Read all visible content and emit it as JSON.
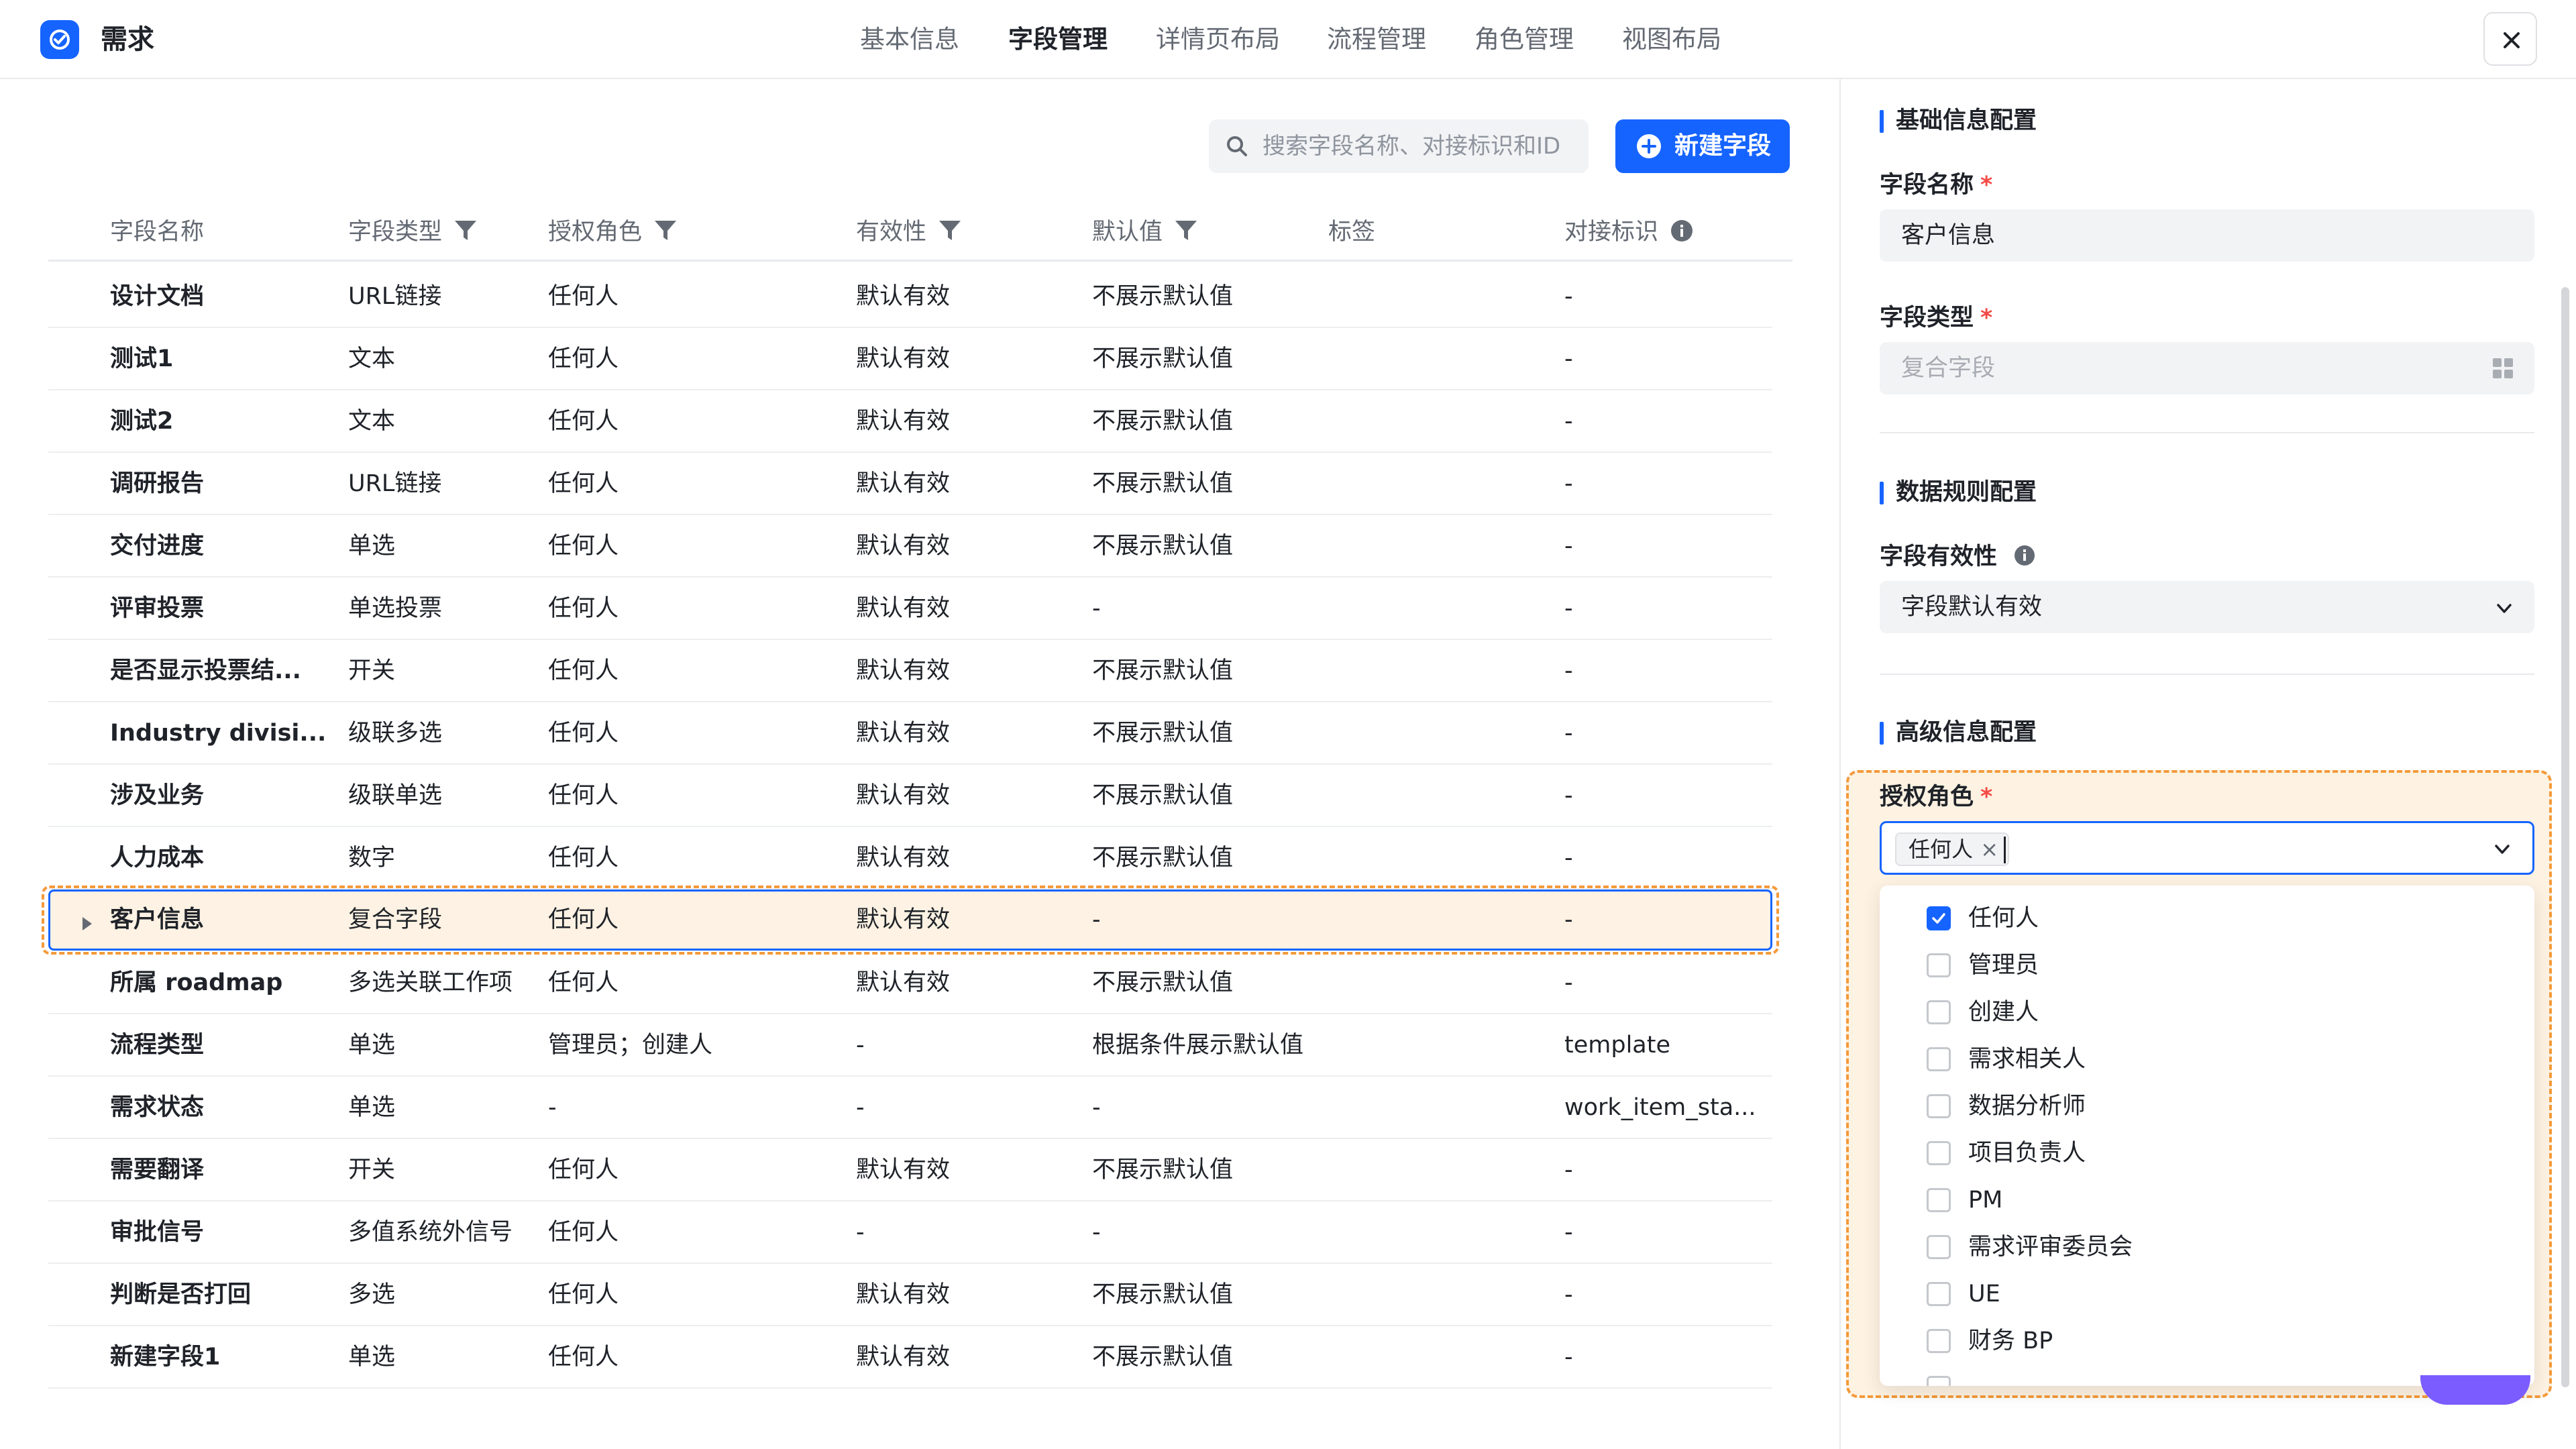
{
  "app": {
    "title": "需求"
  },
  "nav": {
    "tabs": [
      {
        "label": "基本信息",
        "active": false
      },
      {
        "label": "字段管理",
        "active": true
      },
      {
        "label": "详情页布局",
        "active": false
      },
      {
        "label": "流程管理",
        "active": false
      },
      {
        "label": "角色管理",
        "active": false
      },
      {
        "label": "视图布局",
        "active": false
      }
    ]
  },
  "toolbar": {
    "search_placeholder": "搜索字段名称、对接标识和ID",
    "new_field_label": "新建字段"
  },
  "table": {
    "columns": [
      "字段名称",
      "字段类型",
      "授权角色",
      "有效性",
      "默认值",
      "标签",
      "对接标识"
    ],
    "rows": [
      {
        "name": "设计文档",
        "type": "URL链接",
        "role": "任何人",
        "validity": "默认有效",
        "default": "不展示默认值",
        "tag": "",
        "key": "-"
      },
      {
        "name": "测试1",
        "type": "文本",
        "role": "任何人",
        "validity": "默认有效",
        "default": "不展示默认值",
        "tag": "",
        "key": "-"
      },
      {
        "name": "测试2",
        "type": "文本",
        "role": "任何人",
        "validity": "默认有效",
        "default": "不展示默认值",
        "tag": "",
        "key": "-"
      },
      {
        "name": "调研报告",
        "type": "URL链接",
        "role": "任何人",
        "validity": "默认有效",
        "default": "不展示默认值",
        "tag": "",
        "key": "-"
      },
      {
        "name": "交付进度",
        "type": "单选",
        "role": "任何人",
        "validity": "默认有效",
        "default": "不展示默认值",
        "tag": "",
        "key": "-"
      },
      {
        "name": "评审投票",
        "type": "单选投票",
        "role": "任何人",
        "validity": "默认有效",
        "default": "-",
        "tag": "",
        "key": "-"
      },
      {
        "name": "是否显示投票结...",
        "type": "开关",
        "role": "任何人",
        "validity": "默认有效",
        "default": "不展示默认值",
        "tag": "",
        "key": "-"
      },
      {
        "name": "Industry divisi...",
        "type": "级联多选",
        "role": "任何人",
        "validity": "默认有效",
        "default": "不展示默认值",
        "tag": "",
        "key": "-"
      },
      {
        "name": "涉及业务",
        "type": "级联单选",
        "role": "任何人",
        "validity": "默认有效",
        "default": "不展示默认值",
        "tag": "",
        "key": "-"
      },
      {
        "name": "人力成本",
        "type": "数字",
        "role": "任何人",
        "validity": "默认有效",
        "default": "不展示默认值",
        "tag": "",
        "key": "-"
      },
      {
        "name": "客户信息",
        "type": "复合字段",
        "role": "任何人",
        "validity": "默认有效",
        "default": "-",
        "tag": "",
        "key": "-",
        "selected": true
      },
      {
        "name": "所属 roadmap",
        "type": "多选关联工作项",
        "role": "任何人",
        "validity": "默认有效",
        "default": "不展示默认值",
        "tag": "",
        "key": "-"
      },
      {
        "name": "流程类型",
        "type": "单选",
        "role": "管理员；创建人",
        "validity": "-",
        "default": "根据条件展示默认值",
        "tag": "",
        "key": "template"
      },
      {
        "name": "需求状态",
        "type": "单选",
        "role": "-",
        "validity": "-",
        "default": "-",
        "tag": "",
        "key": "work_item_sta..."
      },
      {
        "name": "需要翻译",
        "type": "开关",
        "role": "任何人",
        "validity": "默认有效",
        "default": "不展示默认值",
        "tag": "",
        "key": "-"
      },
      {
        "name": "审批信号",
        "type": "多值系统外信号",
        "role": "任何人",
        "validity": "-",
        "default": "-",
        "tag": "",
        "key": "-"
      },
      {
        "name": "判断是否打回",
        "type": "多选",
        "role": "任何人",
        "validity": "默认有效",
        "default": "不展示默认值",
        "tag": "",
        "key": "-"
      },
      {
        "name": "新建字段1",
        "type": "单选",
        "role": "任何人",
        "validity": "默认有效",
        "default": "不展示默认值",
        "tag": "",
        "key": "-"
      }
    ]
  },
  "panel": {
    "basic_title": "基础信息配置",
    "field_name_label": "字段名称",
    "field_name_value": "客户信息",
    "field_type_label": "字段类型",
    "field_type_value": "复合字段",
    "rules_title": "数据规则配置",
    "validity_label": "字段有效性",
    "validity_value": "字段默认有效",
    "advanced_title": "高级信息配置",
    "role_label": "授权角色",
    "required_mark": "*",
    "role_tag": "任何人",
    "role_tag_remove": "×",
    "role_options": [
      {
        "label": "任何人",
        "checked": true
      },
      {
        "label": "管理员",
        "checked": false
      },
      {
        "label": "创建人",
        "checked": false
      },
      {
        "label": "需求相关人",
        "checked": false
      },
      {
        "label": "数据分析师",
        "checked": false
      },
      {
        "label": "项目负责人",
        "checked": false
      },
      {
        "label": "PM",
        "checked": false
      },
      {
        "label": "需求评审委员会",
        "checked": false
      },
      {
        "label": "UE",
        "checked": false
      },
      {
        "label": "财务 BP",
        "checked": false
      }
    ]
  },
  "colors": {
    "accent": "#1664ff",
    "highlight": "#f39a3b",
    "selected_bg": "#fdf2e3"
  }
}
